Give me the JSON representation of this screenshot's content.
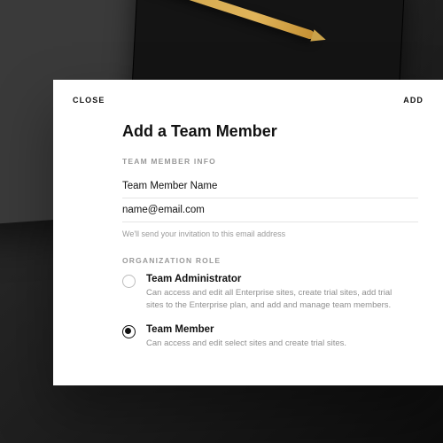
{
  "header": {
    "close_label": "CLOSE",
    "add_label": "ADD"
  },
  "title": "Add a Team Member",
  "sections": {
    "info_label": "TEAM MEMBER INFO",
    "role_label": "ORGANIZATION ROLE"
  },
  "fields": {
    "name_placeholder": "Team Member Name",
    "name_value": "",
    "email_placeholder": "name@email.com",
    "email_value": "",
    "email_hint": "We'll send your invitation to this email address"
  },
  "roles": {
    "admin": {
      "title": "Team Administrator",
      "desc": "Can access and edit all Enterprise sites, create trial sites, add trial sites to the Enterprise plan, and add and manage team members.",
      "selected": false
    },
    "member": {
      "title": "Team Member",
      "desc": "Can access and edit select sites and create trial sites.",
      "selected": true
    }
  }
}
